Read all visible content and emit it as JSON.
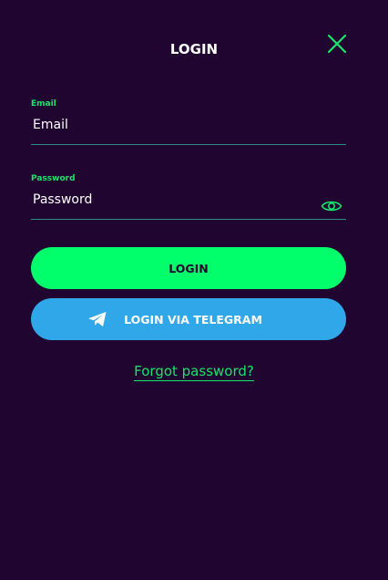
{
  "header": {
    "title": "LOGIN",
    "close_icon": "close-icon"
  },
  "form": {
    "email": {
      "label": "Email",
      "placeholder": "Email",
      "value": ""
    },
    "password": {
      "label": "Password",
      "placeholder": "Password",
      "value": "",
      "toggle_icon": "eye-icon"
    }
  },
  "actions": {
    "login_label": "LOGIN",
    "telegram_label": "LOGIN VIA TELEGRAM",
    "telegram_icon": "telegram-icon",
    "forgot_label": "Forgot password?"
  },
  "colors": {
    "background": "#1f0530",
    "accent_green": "#00ff6a",
    "label_green": "#19e46b",
    "telegram_blue": "#2fa7e8",
    "underline": "#2f8a83"
  }
}
